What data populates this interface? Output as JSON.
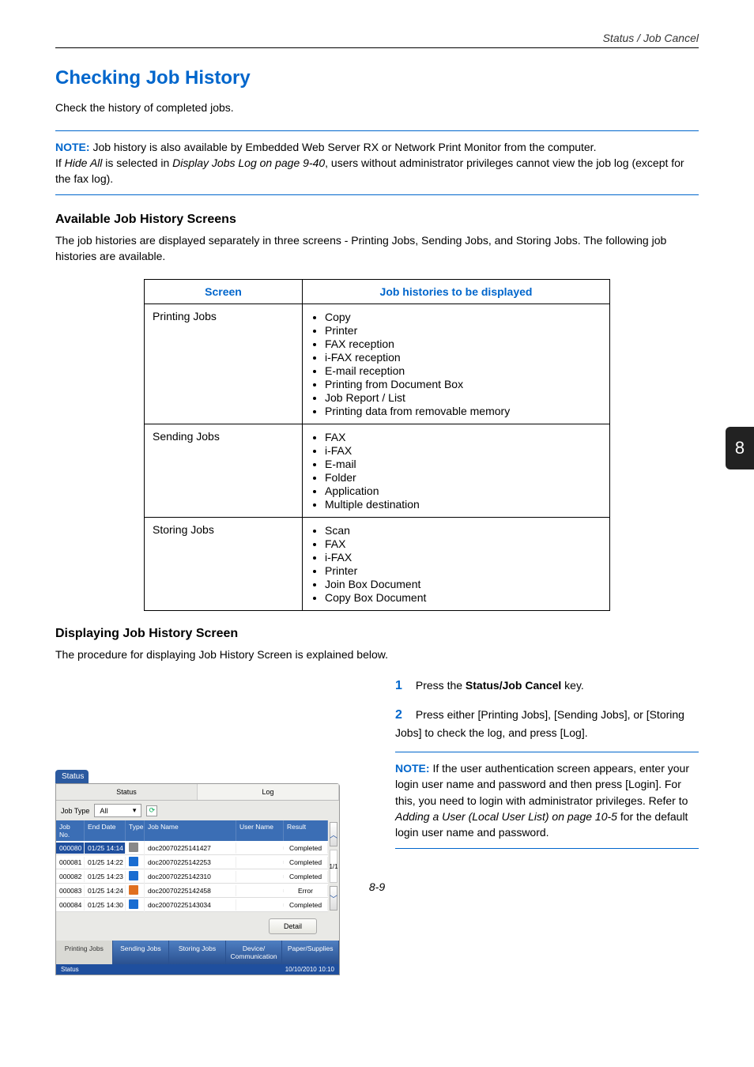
{
  "header": {
    "section_title": "Status / Job Cancel"
  },
  "h1": "Checking Job History",
  "intro": "Check the history of completed jobs.",
  "note1": {
    "label": "NOTE:",
    "line1": " Job history is also available by Embedded Web Server RX or Network Print Monitor from the computer.",
    "line2_a": "If ",
    "line2_b": "Hide All",
    "line2_c": " is selected in ",
    "line2_d": "Display Jobs Log on page 9-40",
    "line2_e": ", users without administrator privileges cannot view the job log (except for the fax log)."
  },
  "h2a": "Available Job History Screens",
  "p2": "The job histories are displayed separately in three screens - Printing Jobs, Sending Jobs, and Storing Jobs. The following job histories are available.",
  "table_head": {
    "c1": "Screen",
    "c2": "Job histories to be displayed"
  },
  "table_rows": [
    {
      "screen": "Printing Jobs",
      "items": [
        "Copy",
        "Printer",
        "FAX reception",
        "i-FAX reception",
        "E-mail reception",
        "Printing from Document Box",
        "Job Report / List",
        "Printing data from removable memory"
      ]
    },
    {
      "screen": "Sending Jobs",
      "items": [
        "FAX",
        "i-FAX",
        "E-mail",
        "Folder",
        "Application",
        "Multiple destination"
      ]
    },
    {
      "screen": "Storing Jobs",
      "items": [
        "Scan",
        "FAX",
        "i-FAX",
        "Printer",
        "Join Box Document",
        "Copy Box Document"
      ]
    }
  ],
  "h2b": "Displaying Job History Screen",
  "p3": "The procedure for displaying Job History Screen is explained below.",
  "steps": [
    {
      "n": "1",
      "pre": "Press the ",
      "bold": "Status/Job Cancel",
      "post": " key."
    },
    {
      "n": "2",
      "pre": "Press either [Printing Jobs], [Sending Jobs], or [Storing Jobs] to check the log, and press [Log].",
      "bold": "",
      "post": ""
    }
  ],
  "note2": {
    "label": "NOTE:",
    "a": " If the user authentication screen appears, enter your login user name and password and then press [Login]. For this, you need to login with administrator privileges. Refer to ",
    "b": "Adding a User (Local User List) on page 10-5",
    "c": " for the default login user name and password."
  },
  "sidetab": "8",
  "pagenum": "8-9",
  "panel": {
    "title": "Status",
    "toptabs": {
      "status": "Status",
      "log": "Log"
    },
    "filter": {
      "label": "Job Type",
      "value": "All"
    },
    "cols": {
      "no": "Job No.",
      "date": "End Date",
      "type": "Type",
      "name": "Job Name",
      "user": "User Name",
      "res": "Result"
    },
    "rows": [
      {
        "no": "000080",
        "date": "01/25 14:14",
        "icon": "gray",
        "name": "doc20070225141427",
        "user": "",
        "res": "Completed",
        "sel": true
      },
      {
        "no": "000081",
        "date": "01/25 14:22",
        "icon": "blue",
        "name": "doc20070225142253",
        "user": "",
        "res": "Completed"
      },
      {
        "no": "000082",
        "date": "01/25 14:23",
        "icon": "blue",
        "name": "doc20070225142310",
        "user": "",
        "res": "Completed"
      },
      {
        "no": "000083",
        "date": "01/25 14:24",
        "icon": "orange",
        "name": "doc20070225142458",
        "user": "",
        "res": "Error"
      },
      {
        "no": "000084",
        "date": "01/25 14:30",
        "icon": "blue",
        "name": "doc20070225143034",
        "user": "",
        "res": "Completed"
      }
    ],
    "page_indicator": "1/1",
    "detail": "Detail",
    "btabs": [
      "Printing Jobs",
      "Sending Jobs",
      "Storing Jobs",
      "Device/\nCommunication",
      "Paper/Supplies"
    ],
    "statusbar": {
      "left": "Status",
      "right": "10/10/2010  10:10"
    }
  }
}
